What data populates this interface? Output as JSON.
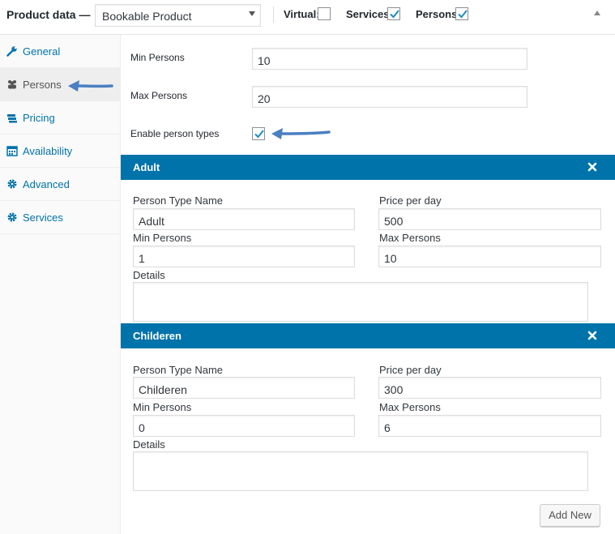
{
  "header": {
    "title": "Product data —",
    "product_type": "Bookable Product",
    "virtual_label": "Virtual:",
    "virtual_checked": false,
    "services_label": "Services:",
    "services_checked": true,
    "persons_label": "Persons:",
    "persons_checked": true
  },
  "sidebar": {
    "items": [
      {
        "label": "General",
        "icon": "wrench-icon"
      },
      {
        "label": "Persons",
        "icon": "people-icon",
        "active": true
      },
      {
        "label": "Pricing",
        "icon": "money-icon"
      },
      {
        "label": "Availability",
        "icon": "calendar-icon"
      },
      {
        "label": "Advanced",
        "icon": "gear-icon"
      },
      {
        "label": "Services",
        "icon": "gear-icon"
      }
    ]
  },
  "persons": {
    "min_label": "Min Persons",
    "min_value": "10",
    "max_label": "Max Persons",
    "max_value": "20",
    "enable_types_label": "Enable person types",
    "enable_types_checked": true
  },
  "person_types": [
    {
      "title": "Adult",
      "name_label": "Person Type Name",
      "name_value": "Adult",
      "price_label": "Price per day",
      "price_value": "500",
      "min_label": "Min Persons",
      "min_value": "1",
      "max_label": "Max Persons",
      "max_value": "10",
      "details_label": "Details",
      "details_value": ""
    },
    {
      "title": "Childeren",
      "name_label": "Person Type Name",
      "name_value": "Childeren",
      "price_label": "Price per day",
      "price_value": "300",
      "min_label": "Min Persons",
      "min_value": "0",
      "max_label": "Max Persons",
      "max_value": "6",
      "details_label": "Details",
      "details_value": ""
    }
  ],
  "add_new_label": "Add New",
  "colors": {
    "accent": "#0073aa",
    "arrow": "#4a7fc1"
  }
}
